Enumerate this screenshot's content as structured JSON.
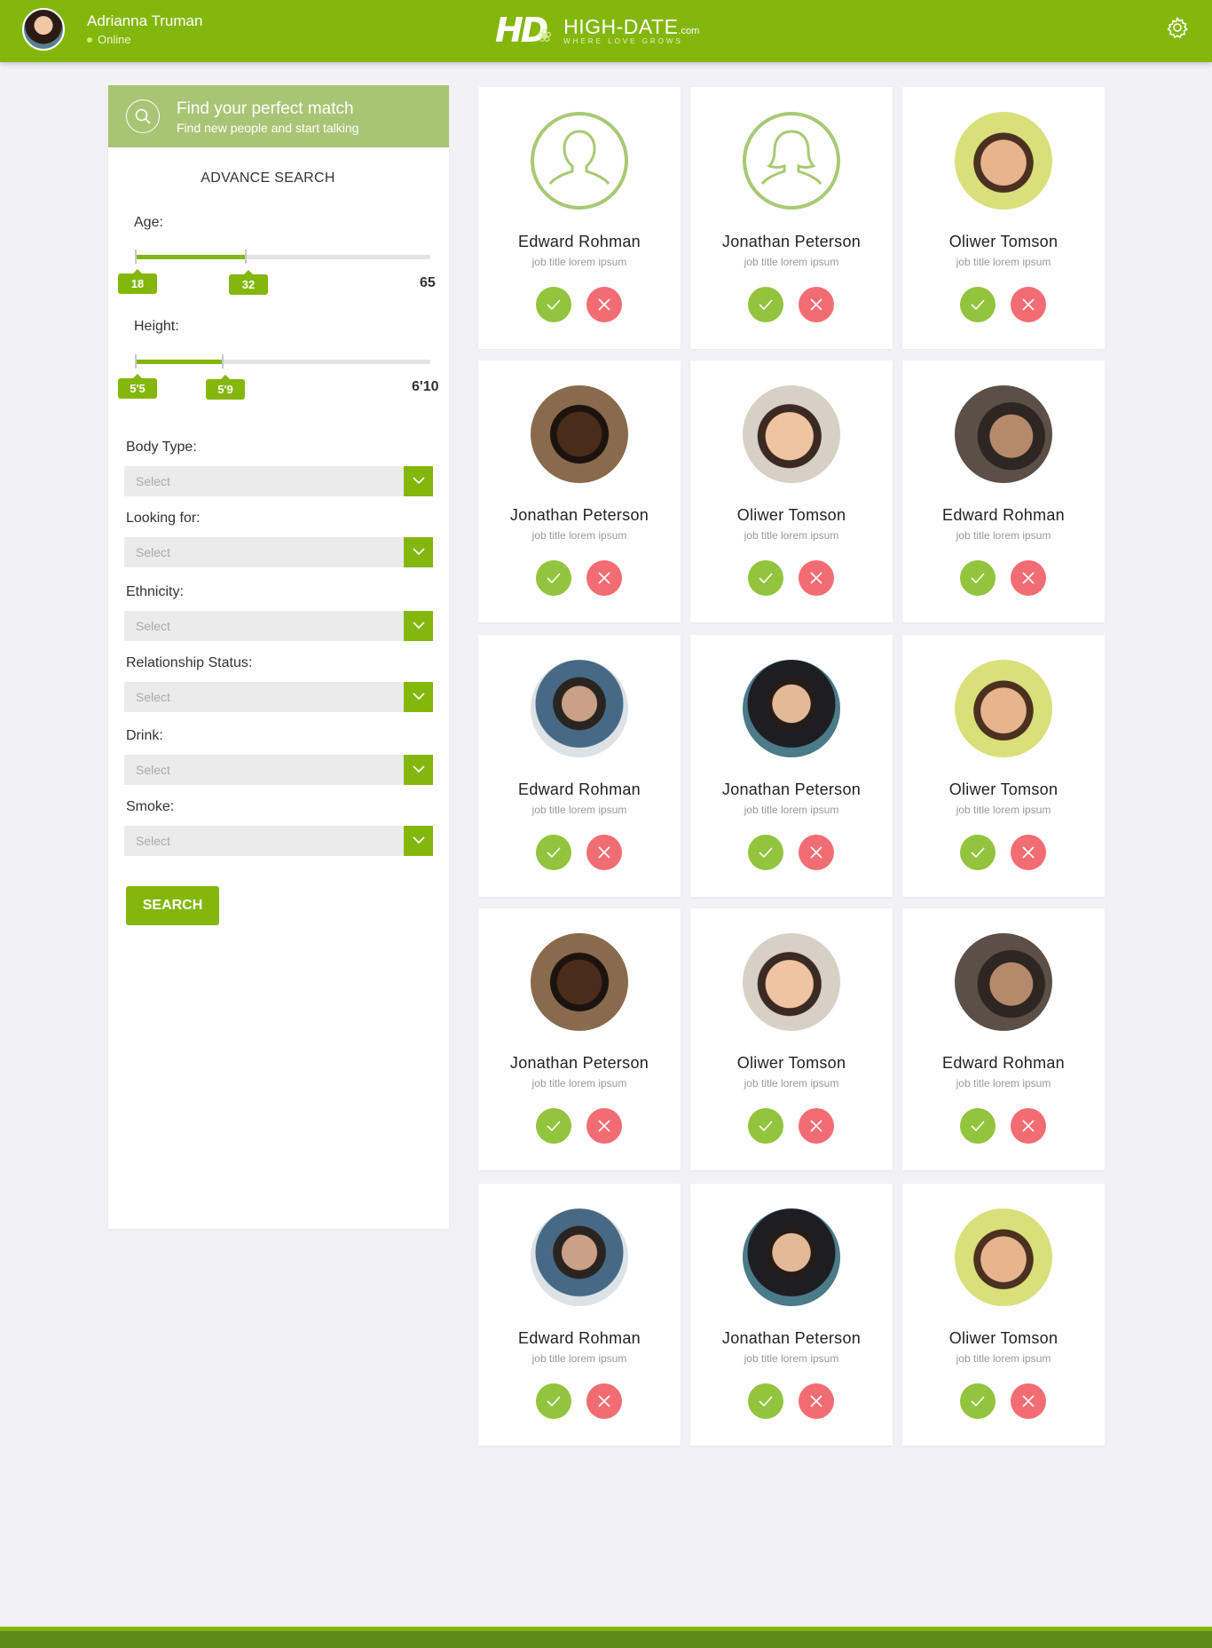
{
  "header": {
    "user_name": "Adrianna Truman",
    "user_status": "Online",
    "logo_mark": "HD",
    "logo_name": "HIGH-DATE",
    "logo_com": ".com",
    "logo_tagline": "WHERE LOVE GROWS",
    "settings_icon": "gear-icon"
  },
  "sidebar": {
    "title": "Find your perfect match",
    "subtitle": "Find new people and start talking",
    "advance_title": "ADVANCE SEARCH",
    "age": {
      "label": "Age:",
      "min_label": "18",
      "max_label": "32",
      "range_max": "65",
      "min": 18,
      "max": 32,
      "limit_min": 18,
      "limit_max": 65
    },
    "height": {
      "label": "Height:",
      "min_label": "5'5",
      "max_label": "5'9",
      "range_max": "6'10"
    },
    "filters": [
      {
        "label": "Body Type:",
        "value": "Select"
      },
      {
        "label": "Looking for:",
        "value": "Select"
      },
      {
        "label": "Ethnicity:",
        "value": "Select"
      },
      {
        "label": "Relationship Status:",
        "value": "Select"
      },
      {
        "label": "Drink:",
        "value": "Select"
      },
      {
        "label": "Smoke:",
        "value": "Select"
      }
    ],
    "search_button": "SEARCH"
  },
  "colors": {
    "brand": "#84b70c",
    "like": "#92c43d",
    "dislike": "#f26d73",
    "header_light": "#a8c575"
  },
  "cards": [
    {
      "name": "Edward Rohman",
      "job": "job title lorem ipsum",
      "photo": "placeholder-male"
    },
    {
      "name": "Jonathan Peterson",
      "job": "job title lorem ipsum",
      "photo": "placeholder-female"
    },
    {
      "name": "Oliwer Tomson",
      "job": "job title lorem ipsum",
      "photo": "photo-smile"
    },
    {
      "name": "Jonathan Peterson",
      "job": "job title lorem ipsum",
      "photo": "photo-dark"
    },
    {
      "name": "Oliwer Tomson",
      "job": "job title lorem ipsum",
      "photo": "photo-laugh"
    },
    {
      "name": "Edward Rohman",
      "job": "job title lorem ipsum",
      "photo": "photo-shadow"
    },
    {
      "name": "Edward Rohman",
      "job": "job title lorem ipsum",
      "photo": "photo-glasses"
    },
    {
      "name": "Jonathan Peterson",
      "job": "job title lorem ipsum",
      "photo": "photo-city"
    },
    {
      "name": "Oliwer Tomson",
      "job": "job title lorem ipsum",
      "photo": "photo-smile"
    },
    {
      "name": "Jonathan Peterson",
      "job": "job title lorem ipsum",
      "photo": "photo-dark"
    },
    {
      "name": "Oliwer Tomson",
      "job": "job title lorem ipsum",
      "photo": "photo-laugh"
    },
    {
      "name": "Edward Rohman",
      "job": "job title lorem ipsum",
      "photo": "photo-shadow"
    },
    {
      "name": "Edward Rohman",
      "job": "job title lorem ipsum",
      "photo": "photo-glasses"
    },
    {
      "name": "Jonathan Peterson",
      "job": "job title lorem ipsum",
      "photo": "photo-city"
    },
    {
      "name": "Oliwer Tomson",
      "job": "job title lorem ipsum",
      "photo": "photo-smile"
    }
  ]
}
